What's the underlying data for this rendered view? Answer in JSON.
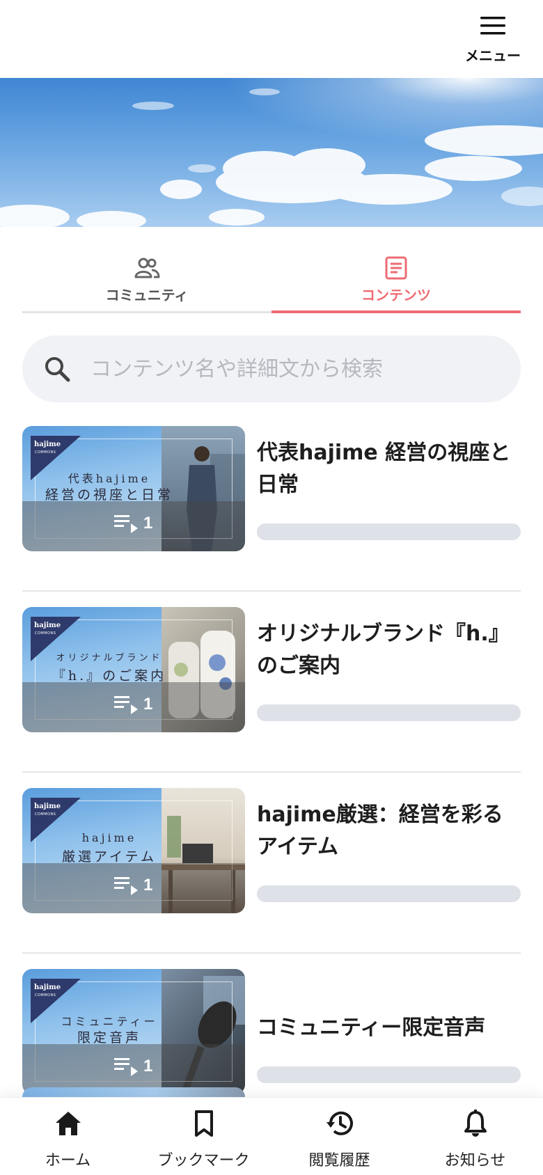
{
  "header": {
    "menu_label": "メニュー",
    "menu_icon": "hamburger-menu-icon"
  },
  "tabs": [
    {
      "label": "コミュニティ",
      "icon": "people-icon",
      "active": false
    },
    {
      "label": "コンテンツ",
      "icon": "document-icon",
      "active": true
    }
  ],
  "search": {
    "placeholder": "コンテンツ名や詳細文から検索",
    "value": ""
  },
  "contents": [
    {
      "title": "代表hajime 経営の視座と日常",
      "thumb_line1": "代表hajime",
      "thumb_line2": "経営の視座と日常",
      "count": "1"
    },
    {
      "title": "オリジナルブランド『h.』のご案内",
      "thumb_line1": "オリジナルブランド",
      "thumb_line2": "『h.』のご案内",
      "count": "1"
    },
    {
      "title": "hajime厳選：経営を彩るアイテム",
      "thumb_line1": "hajime",
      "thumb_line2": "厳選アイテム",
      "count": "1"
    },
    {
      "title": "コミュニティー限定音声",
      "thumb_line1": "コミュニティー",
      "thumb_line2": "限定音声",
      "count": "1"
    }
  ],
  "thumb_logo": {
    "name": "hajime",
    "sub": "COMMONS"
  },
  "bottom_nav": [
    {
      "label": "ホーム",
      "icon": "home-icon"
    },
    {
      "label": "ブックマーク",
      "icon": "bookmark-icon"
    },
    {
      "label": "閲覧履歴",
      "icon": "history-icon"
    },
    {
      "label": "お知らせ",
      "icon": "bell-icon"
    }
  ],
  "colors": {
    "accent": "#ee6b73",
    "search_bg": "#f1f2f6",
    "placeholder_bar": "#dfe1e8"
  }
}
